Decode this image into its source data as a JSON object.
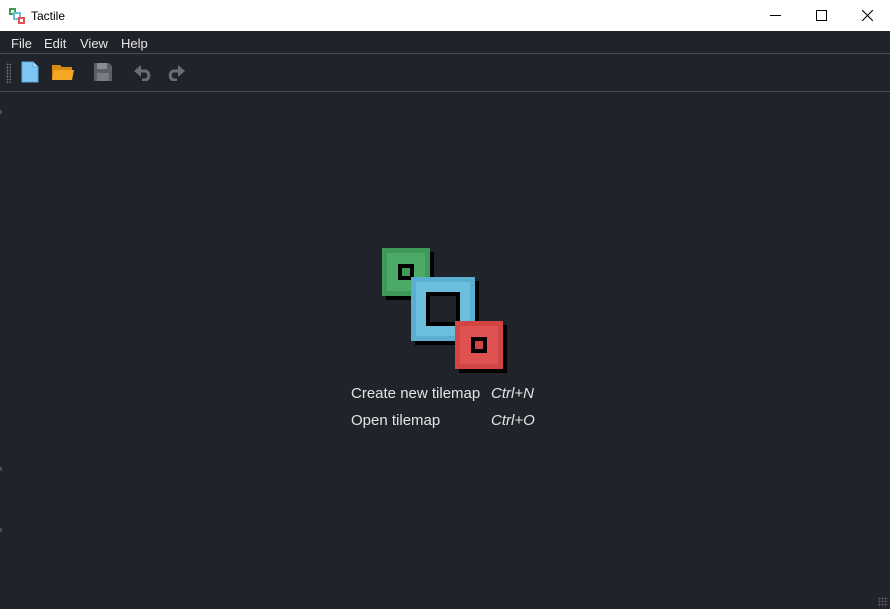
{
  "window": {
    "title": "Tactile",
    "controls": {
      "minimize_icon": "minimize-icon",
      "maximize_icon": "maximize-icon",
      "close_icon": "close-icon"
    }
  },
  "menubar": {
    "items": [
      {
        "label": "File"
      },
      {
        "label": "Edit"
      },
      {
        "label": "View"
      },
      {
        "label": "Help"
      }
    ]
  },
  "toolbar": {
    "buttons": [
      {
        "icon": "new-file-icon",
        "enabled": true
      },
      {
        "icon": "open-folder-icon",
        "enabled": true
      },
      {
        "icon": "save-icon",
        "enabled": false
      },
      {
        "icon": "undo-icon",
        "enabled": false
      },
      {
        "icon": "redo-icon",
        "enabled": false
      }
    ]
  },
  "start_page": {
    "logo": "tactile-logo",
    "actions": [
      {
        "label": "Create new tilemap",
        "shortcut": "Ctrl+N"
      },
      {
        "label": "Open tilemap",
        "shortcut": "Ctrl+O"
      }
    ]
  },
  "colors": {
    "background": "#21232a",
    "text": "#e3e3e3",
    "logo_green": "#3f9a5a",
    "logo_blue": "#6cbedd",
    "logo_red": "#e05252",
    "folder_orange": "#f5a623",
    "file_blue": "#7fc6f5"
  }
}
